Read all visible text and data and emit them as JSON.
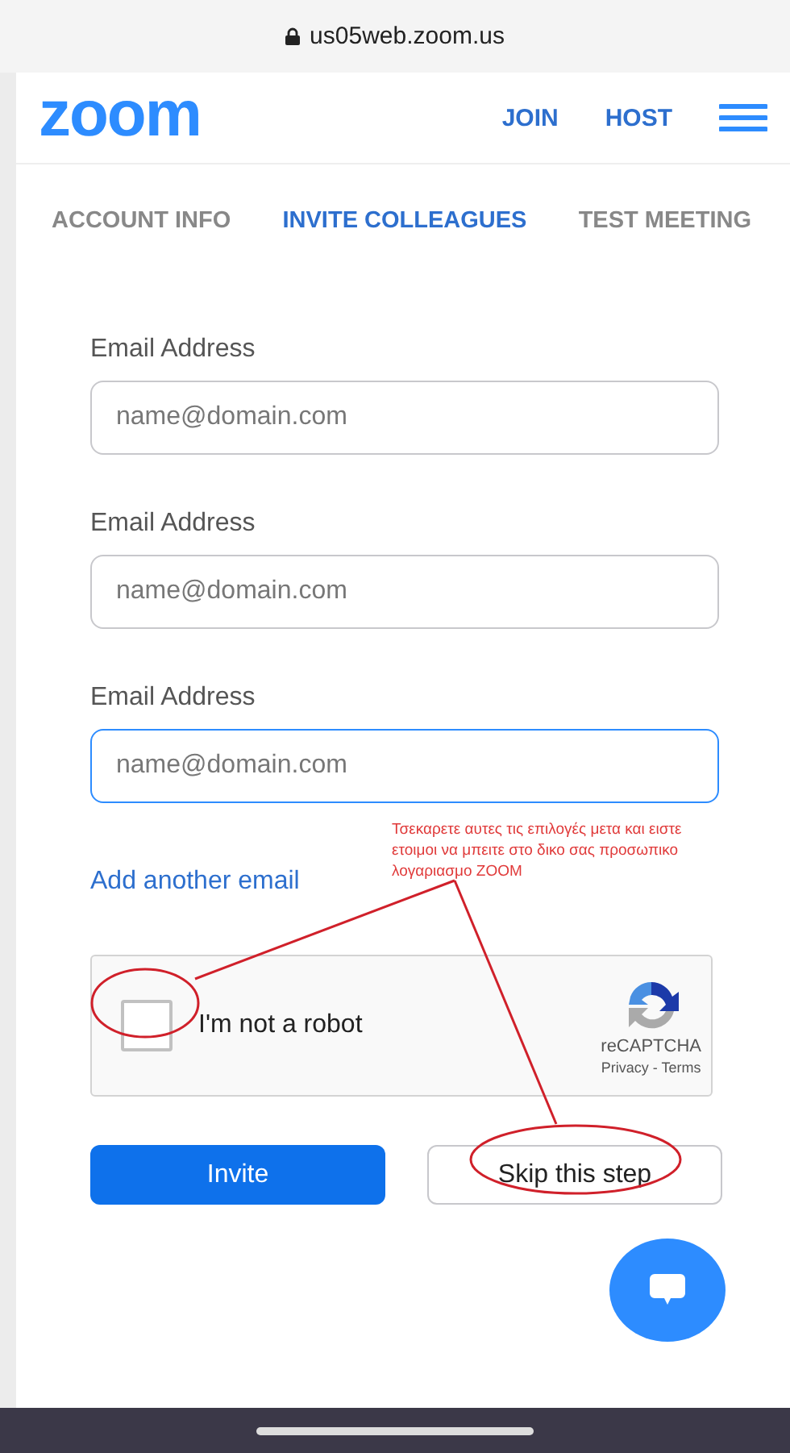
{
  "address_bar": {
    "url": "us05web.zoom.us"
  },
  "header": {
    "logo": "zoom",
    "links": [
      "JOIN",
      "HOST"
    ]
  },
  "tabs": [
    {
      "label": "ACCOUNT INFO",
      "selected": false
    },
    {
      "label": "INVITE COLLEAGUES",
      "selected": true
    },
    {
      "label": "TEST MEETING",
      "selected": false
    }
  ],
  "email_fields": [
    {
      "label": "Email Address",
      "placeholder": "name@domain.com",
      "focused": false
    },
    {
      "label": "Email Address",
      "placeholder": "name@domain.com",
      "focused": false
    },
    {
      "label": "Email Address",
      "placeholder": "name@domain.com",
      "focused": true
    }
  ],
  "add_link": "Add another email",
  "annotation": "Τσεκαρετε αυτες τις επιλογές μετα και ειστε ετοιμοι να μπειτε στο δικο σας προσωπικο λογαριασμο ZOOM",
  "recaptcha": {
    "label": "I'm not a robot",
    "checked": false,
    "brand": "reCAPTCHA",
    "links": "Privacy - Terms"
  },
  "buttons": [
    {
      "label": "Invite",
      "kind": "primary"
    },
    {
      "label": "Skip this step",
      "kind": "secondary"
    }
  ]
}
